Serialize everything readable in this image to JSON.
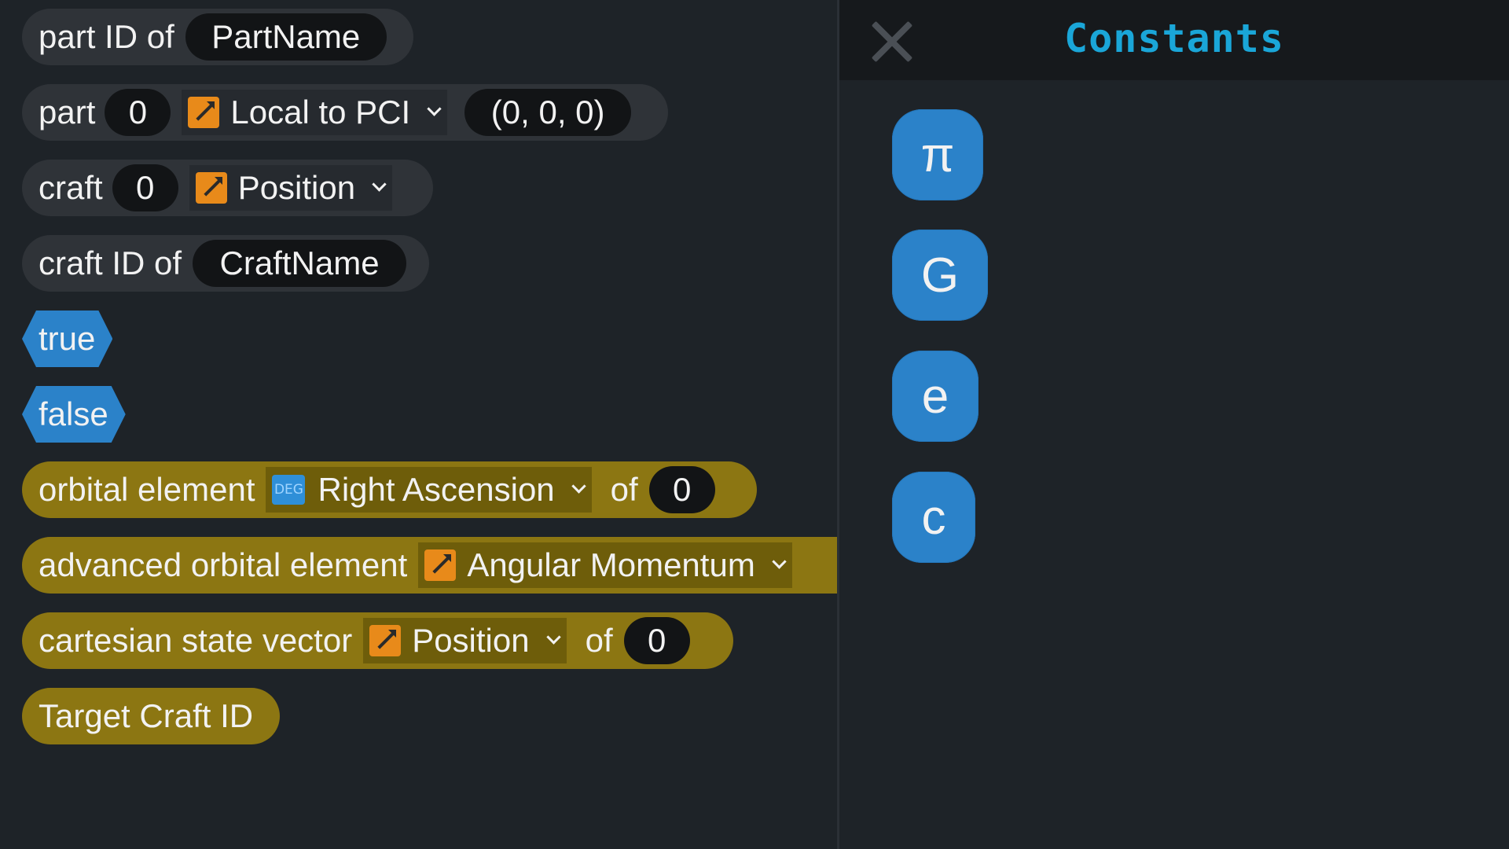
{
  "toolbox": {
    "part_id": {
      "label": "part ID of",
      "value": "PartName"
    },
    "part_transform": {
      "label": "part",
      "index": "0",
      "dropdown": "Local to PCI",
      "vector": "(0, 0, 0)"
    },
    "craft_property": {
      "label": "craft",
      "index": "0",
      "dropdown": "Position"
    },
    "craft_id": {
      "label": "craft ID of",
      "value": "CraftName"
    },
    "true_label": "true",
    "false_label": "false",
    "orbital_element": {
      "label": "orbital element",
      "icon_text": "DEG",
      "dropdown": "Right Ascension",
      "of": "of",
      "value": "0"
    },
    "advanced_orbital_element": {
      "label": "advanced orbital element",
      "dropdown": "Angular Momentum"
    },
    "cartesian_state_vector": {
      "label": "cartesian state vector",
      "dropdown": "Position",
      "of": "of",
      "value": "0"
    },
    "target_craft_id": {
      "label": "Target Craft ID"
    }
  },
  "panel": {
    "title": "Constants",
    "constants": [
      "π",
      "G",
      "e",
      "c"
    ]
  },
  "colors": {
    "background": "#1e2328",
    "header": "#16191c",
    "title": "#1aa6d8",
    "gray_block": "#2f3338",
    "olive_block": "#8c7612",
    "blue_block": "#2b82c9",
    "vector_icon": "#e88a1a"
  },
  "icons": {
    "vector_icon": "vector-arrow-icon",
    "degree_icon": "degree-icon",
    "close_icon": "close-icon",
    "dropdown_icon": "chevron-down-icon"
  }
}
